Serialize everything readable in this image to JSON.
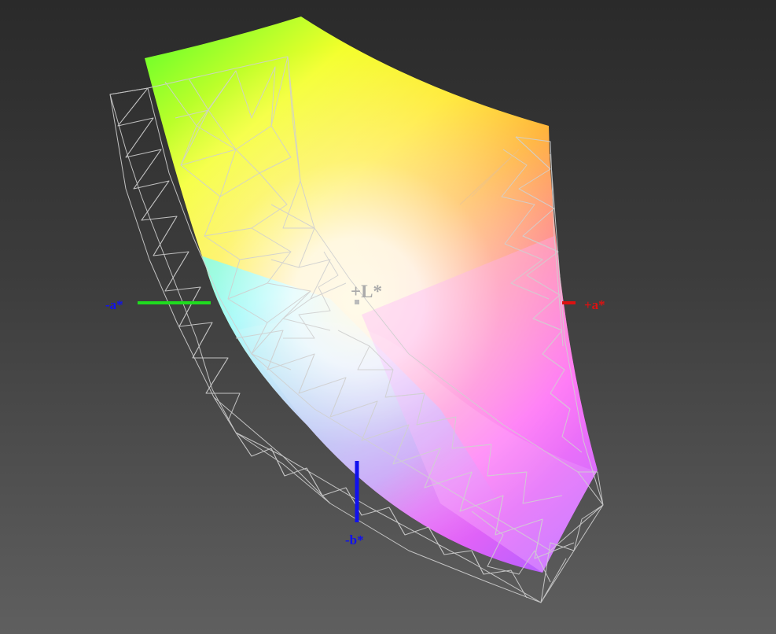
{
  "axes": {
    "neg_a_label": "-a*",
    "pos_a_label": "+a*",
    "neg_b_label": "-b*",
    "pos_l_label": "+L*"
  },
  "colors": {
    "neg_a_axis": "#1fdc1f",
    "pos_a_axis": "#dd1111",
    "neg_b_axis": "#1111ee",
    "pos_l_label": "#aaaaaa",
    "wireframe": "#d0d0d0"
  }
}
